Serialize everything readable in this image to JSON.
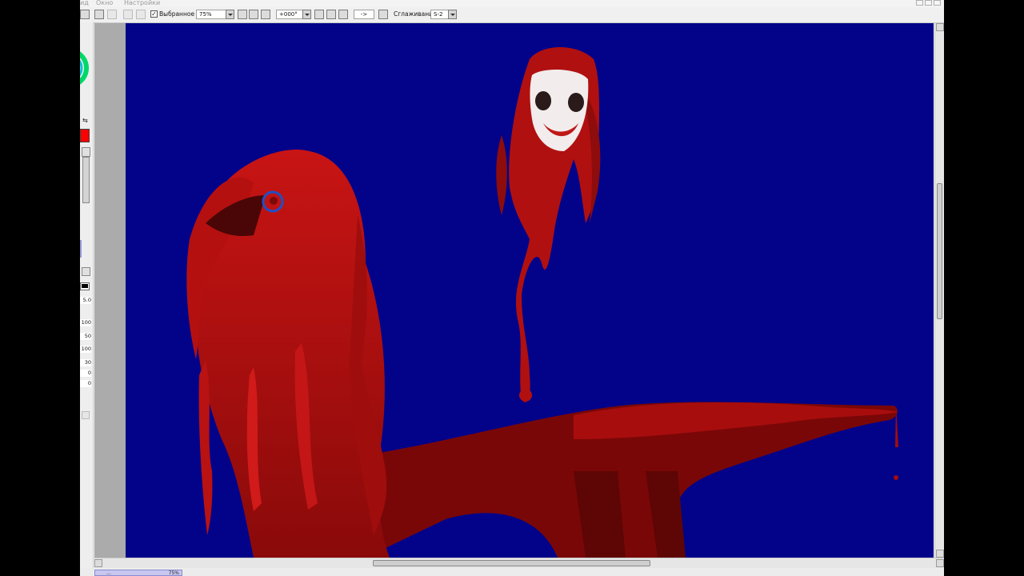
{
  "menu": {
    "items": [
      "ид",
      "Окно",
      "Настройки"
    ]
  },
  "toolbar": {
    "selection_checkbox_label": "Выбранное",
    "selection_checked": true,
    "zoom_value": "75%",
    "rotation_value": "+000°",
    "flip_value": "->",
    "smoothing_label": "Сглаживание",
    "smoothing_value": "S-2"
  },
  "left_panel": {
    "primary_color": "#ff0000",
    "values": [
      "5.0",
      "100",
      "50",
      "100",
      "30",
      "0",
      "0"
    ]
  },
  "canvas": {
    "background_color": "#030389"
  },
  "document_tab": {
    "name": "...",
    "zoom": "75%"
  }
}
